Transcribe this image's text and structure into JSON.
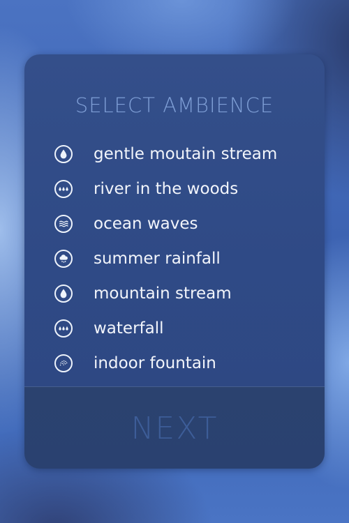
{
  "screen": {
    "title": "SELECT AMBIENCE",
    "options": [
      {
        "label": "gentle moutain stream",
        "icon": "droplet-icon"
      },
      {
        "label": "river in the woods",
        "icon": "droplets-icon"
      },
      {
        "label": "ocean waves",
        "icon": "waves-icon"
      },
      {
        "label": "summer rainfall",
        "icon": "rain-cloud-icon"
      },
      {
        "label": "mountain stream",
        "icon": "droplet-icon"
      },
      {
        "label": "waterfall",
        "icon": "droplets-icon"
      },
      {
        "label": "indoor fountain",
        "icon": "fountain-icon"
      }
    ],
    "next_label": "NEXT"
  },
  "colors": {
    "title": "#7f9fd6",
    "option_text": "#f2f5fb",
    "next_text": "#3d5d98",
    "panel": "#304b87"
  }
}
